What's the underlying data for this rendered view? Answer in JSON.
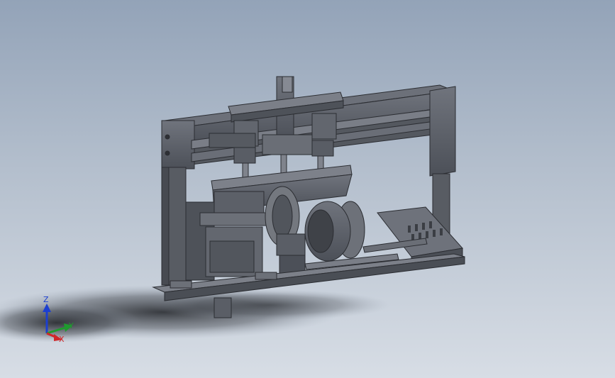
{
  "viewport": {
    "background_top": "#93a3b8",
    "background_bottom": "#d7dde5",
    "model_color": "#5f636c"
  },
  "triad": {
    "z_label": "Z",
    "y_label": "Y",
    "x_label": "X",
    "z_color": "#1c3fd0",
    "y_color": "#1f9a2e",
    "x_color": "#d0262a"
  }
}
